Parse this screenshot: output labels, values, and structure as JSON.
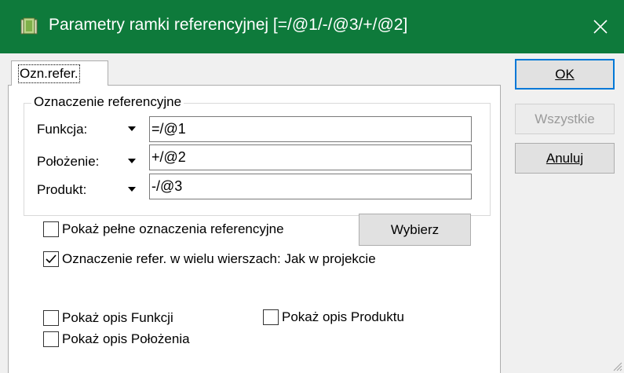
{
  "window": {
    "title": "Parametry ramki referencyjnej [=/@1/-/@3/+/@2]"
  },
  "tabs": [
    {
      "label": "Ozn.refer."
    }
  ],
  "group": {
    "title": "Oznaczenie referencyjne",
    "fields": [
      {
        "label": "Funkcja:",
        "value": "=/@1"
      },
      {
        "label": "Położenie:",
        "value": "+/@2"
      },
      {
        "label": "Produkt:",
        "value": "-/@3"
      }
    ]
  },
  "options": {
    "show_full": {
      "label": "Pokaż pełne oznaczenia referencyjne",
      "checked": false
    },
    "multiline": {
      "label": "Oznaczenie refer. w wielu wierszach: Jak w projekcie",
      "checked": true
    },
    "desc_funkcji": {
      "label": "Pokaż opis Funkcji",
      "checked": false
    },
    "desc_produktu": {
      "label": "Pokaż opis Produktu",
      "checked": false
    },
    "desc_polozenia": {
      "label": "Pokaż opis Położenia",
      "checked": false
    }
  },
  "buttons": {
    "choose": "Wybierz",
    "ok": "OK",
    "all": "Wszystkie",
    "cancel": "Anuluj"
  },
  "colors": {
    "titlebar": "#0e7a3b",
    "default_button_border": "#0078d7"
  },
  "icons": {
    "app": "eplan-frame-icon",
    "close": "close-icon",
    "dropdown": "dropdown-arrow-icon",
    "check": "checkmark-icon"
  }
}
